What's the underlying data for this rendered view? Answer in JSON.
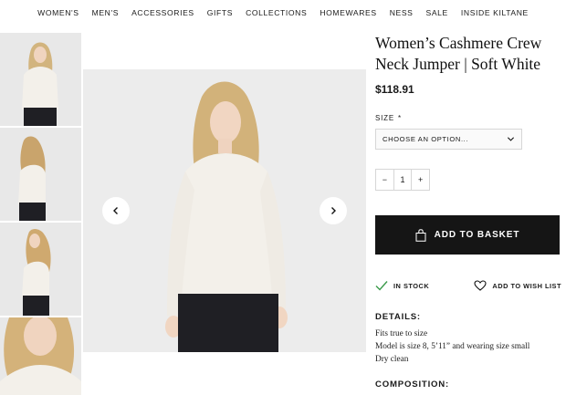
{
  "nav": [
    "WOMEN'S",
    "MEN'S",
    "ACCESSORIES",
    "GIFTS",
    "COLLECTIONS",
    "HOMEWARES",
    "NESS",
    "SALE",
    "INSIDE KILTANE"
  ],
  "product": {
    "title": "Women’s Cashmere Crew Neck Jumper | Soft White",
    "price": "$118.91"
  },
  "size": {
    "label": "SIZE",
    "required": "*",
    "placeholder": "CHOOSE AN OPTION..."
  },
  "quantity": {
    "minus": "−",
    "value": "1",
    "plus": "+"
  },
  "basket": {
    "label": "ADD TO BASKET"
  },
  "stock": {
    "label": "IN STOCK"
  },
  "wishlist": {
    "label": "ADD TO WISH LIST"
  },
  "details": {
    "heading": "DETAILS:",
    "lines": [
      "Fits true to size",
      "Model is size 8, 5’11” and wearing size small",
      "Dry clean"
    ]
  },
  "composition": {
    "heading": "COMPOSITION:"
  },
  "colors": {
    "button": "#151515",
    "check": "#3a9a4a",
    "image_bg": "#ececec",
    "sweater": "#f2efe8"
  },
  "icons": [
    "chevron-left-icon",
    "chevron-right-icon",
    "chevron-down-icon",
    "bag-icon",
    "check-icon",
    "heart-icon"
  ]
}
